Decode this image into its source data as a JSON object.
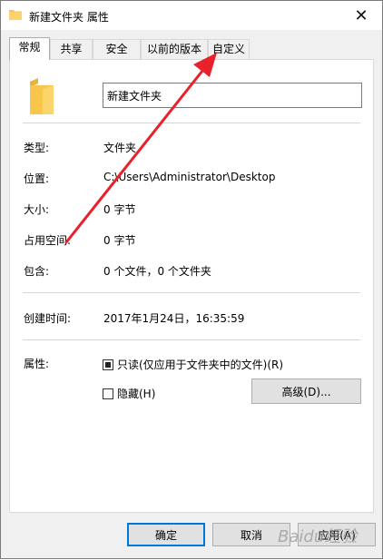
{
  "window": {
    "title": "新建文件夹 属性",
    "close_glyph": "✕"
  },
  "tabs": [
    {
      "label": "常规",
      "active": true
    },
    {
      "label": "共享",
      "active": false
    },
    {
      "label": "安全",
      "active": false
    },
    {
      "label": "以前的版本",
      "active": false
    },
    {
      "label": "自定义",
      "active": false
    }
  ],
  "general": {
    "folder_name": "新建文件夹",
    "rows": [
      {
        "label": "类型:",
        "value": "文件夹"
      },
      {
        "label": "位置:",
        "value": "C:\\Users\\Administrator\\Desktop"
      },
      {
        "label": "大小:",
        "value": "0 字节"
      },
      {
        "label": "占用空间:",
        "value": "0 字节"
      },
      {
        "label": "包含:",
        "value": "0 个文件，0 个文件夹"
      }
    ],
    "created_label": "创建时间:",
    "created_value": "2017年1月24日，16:35:59",
    "attributes_label": "属性:",
    "readonly_label": "只读(仅应用于文件夹中的文件)(R)",
    "readonly_state": "indeterminate",
    "hidden_label": "隐藏(H)",
    "hidden_checked": false,
    "advanced_button": "高级(D)..."
  },
  "footer": {
    "ok": "确定",
    "cancel": "取消",
    "apply": "应用(A)"
  },
  "annotation": {
    "arrow_color": "#e8212b",
    "watermark": "Baidu经验"
  },
  "colors": {
    "folder_yellow": "#f8c64a",
    "accent": "#0078d7"
  }
}
